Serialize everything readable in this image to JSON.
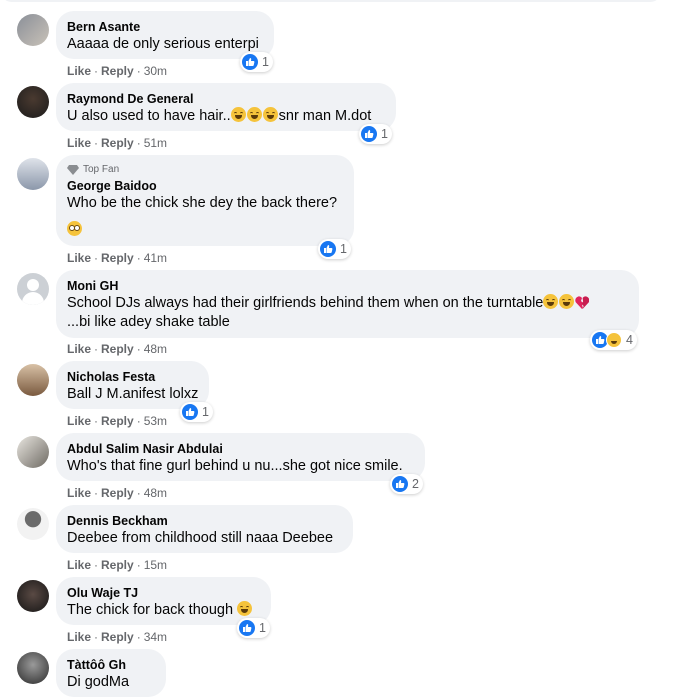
{
  "comments": [
    {
      "name": "Bern Asante",
      "text": "Aaaaa de only serious enterpi",
      "reactions": "1",
      "time": "30m"
    },
    {
      "name": "Raymond De General",
      "text": "U also used to have hair..",
      "text_suffix": "snr man M.dot",
      "reactions": "1",
      "time": "51m"
    },
    {
      "badge": "Top Fan",
      "name": "George Baidoo",
      "text": "Who be the chick she dey the back there?",
      "reactions": "1",
      "time": "41m"
    },
    {
      "name": "Moni GH",
      "text": "School DJs always had their girlfriends behind them when on the turntable",
      "text2": "...bi like adey shake table",
      "reactions": "4",
      "time": "48m"
    },
    {
      "name": "Nicholas Festa",
      "text": "Ball J M.anifest lolxz",
      "reactions": "1",
      "time": "53m"
    },
    {
      "name": "Abdul Salim Nasir Abdulai",
      "text": "Who's that fine gurl behind u nu...she got nice smile.",
      "reactions": "2",
      "time": "48m"
    },
    {
      "name": "Dennis Beckham",
      "text": "Deebee from childhood still naaa Deebee",
      "time": "15m"
    },
    {
      "name": "Olu Waje TJ",
      "text": "The chick for back though",
      "reactions": "1",
      "time": "34m"
    },
    {
      "name": "Tàttôô Gh",
      "text": "Di godMa"
    }
  ],
  "labels": {
    "like": "Like",
    "reply": "Reply",
    "dot": "·"
  },
  "colors": {
    "like_blue": "#1877f2",
    "bubble": "#f0f2f5",
    "meta": "#65676b"
  }
}
